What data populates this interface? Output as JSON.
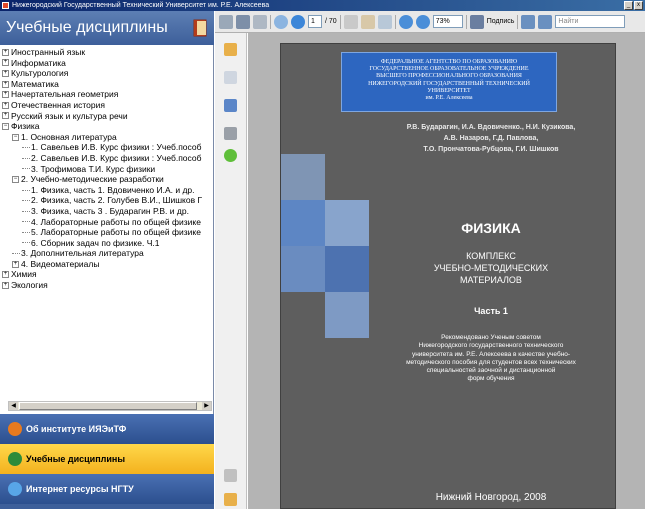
{
  "window": {
    "title": "Нижегородский Государственный Технический Университет им. Р.Е. Алексеева",
    "minimize": "_",
    "close": "x"
  },
  "left_panel": {
    "header": "Учебные дисциплины",
    "tree": [
      {
        "label": "Иностранный язык",
        "level": 0,
        "expander": "+"
      },
      {
        "label": "Информатика",
        "level": 0,
        "expander": "+"
      },
      {
        "label": "Культурология",
        "level": 0,
        "expander": "+"
      },
      {
        "label": "Математика",
        "level": 0,
        "expander": "+"
      },
      {
        "label": "Начертательная геометрия",
        "level": 0,
        "expander": "+"
      },
      {
        "label": "Отечественная история",
        "level": 0,
        "expander": "+"
      },
      {
        "label": "Русский язык и культура речи",
        "level": 0,
        "expander": "+"
      },
      {
        "label": "Физика",
        "level": 0,
        "expander": "−"
      },
      {
        "label": "1. Основная литература",
        "level": 1,
        "expander": "−"
      },
      {
        "label": "1. Савельев И.В. Курс физики : Учеб.пособ",
        "level": 2,
        "expander": ""
      },
      {
        "label": "2. Савельев И.В. Курс физики : Учеб.пособ",
        "level": 2,
        "expander": ""
      },
      {
        "label": "3. Трофимова Т.И. Курс физики",
        "level": 2,
        "expander": ""
      },
      {
        "label": "2. Учебно-методические разработки",
        "level": 1,
        "expander": "−"
      },
      {
        "label": "1. Физика, часть 1. Вдовиченко И.А. и др.",
        "level": 2,
        "expander": ""
      },
      {
        "label": "2. Физика, часть 2. Голубев В.И., Шишков Г",
        "level": 2,
        "expander": ""
      },
      {
        "label": "3. Физика, часть 3 . Бударагин Р.В. и др.",
        "level": 2,
        "expander": ""
      },
      {
        "label": "4. Лабораторные работы по общей физике",
        "level": 2,
        "expander": ""
      },
      {
        "label": "5. Лабораторные работы по общей физике",
        "level": 2,
        "expander": ""
      },
      {
        "label": "6. Сборник задач по физике. Ч.1",
        "level": 2,
        "expander": ""
      },
      {
        "label": "3. Дополнительная литература",
        "level": 1,
        "expander": ""
      },
      {
        "label": "4. Видеоматериалы",
        "level": 1,
        "expander": "+"
      },
      {
        "label": "Химия",
        "level": 0,
        "expander": "+"
      },
      {
        "label": "Экология",
        "level": 0,
        "expander": "+"
      }
    ],
    "nav": {
      "about": "Об институте ИЯЭиТФ",
      "disciplines": "Учебные дисциплины",
      "internet": "Интернет ресурсы НГТУ",
      "more": "»"
    }
  },
  "toolbar": {
    "page_current": "1",
    "page_total": "/ 70",
    "zoom": "73%",
    "sign_label": "Подпись",
    "search_placeholder": "Найти"
  },
  "document": {
    "agency_lines": [
      "ФЕДЕРАЛЬНОЕ АГЕНТСТВО ПО ОБРАЗОВАНИЮ",
      "ГОСУДАРСТВЕННОЕ ОБРАЗОВАТЕЛЬНОЕ УЧРЕЖДЕНИЕ",
      "ВЫСШЕГО ПРОФЕССИОНАЛЬНОГО ОБРАЗОВАНИЯ",
      "НИЖЕГОРОДСКИЙ ГОСУДАРСТВЕННЫЙ ТЕХНИЧЕСКИЙ",
      "УНИВЕРСИТЕТ",
      "им. Р.Е. Алексеева"
    ],
    "authors": [
      "Р.В. Бударагин, И.А. Вдовиченко., Н.И. Кузикова,",
      "А.В. Назаров, Г.Д. Павлова,",
      "Т.О. Прончатова-Рубцова, Г.И. Шишков"
    ],
    "title": "ФИЗИКА",
    "subtitle_lines": [
      "КОМПЛЕКС",
      "УЧЕБНО-МЕТОДИЧЕСКИХ",
      "МАТЕРИАЛОВ"
    ],
    "part": "Часть 1",
    "recommendation_lines": [
      "Рекомендовано Ученым советом",
      "Нижегородского государственного технического",
      "университета им. Р.Е. Алексеева в качестве учебно-",
      "методического пособия для студентов всех технических",
      "специальностей заочной и дистанционной",
      "форм обучения"
    ],
    "city_year": "Нижний Новгород, 2008"
  },
  "colors": {
    "header_blue": "#3d5f9a",
    "active_nav": "#f3b11e",
    "page_bg": "#5e5e5e",
    "agency_box": "#2d66c0"
  }
}
